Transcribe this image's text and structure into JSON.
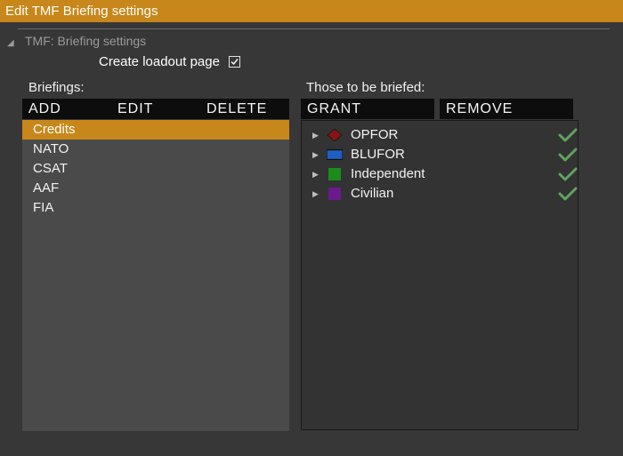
{
  "window": {
    "title": "Edit TMF Briefing settings"
  },
  "section": {
    "title": "TMF: Briefing settings"
  },
  "loadout": {
    "label": "Create loadout page",
    "checked": true
  },
  "briefings": {
    "label": "Briefings:",
    "toolbar": {
      "add": "ADD",
      "edit": "EDIT",
      "delete": "DELETE"
    },
    "items": [
      {
        "label": "Credits",
        "selected": true
      },
      {
        "label": "NATO"
      },
      {
        "label": "CSAT"
      },
      {
        "label": "AAF"
      },
      {
        "label": "FIA"
      }
    ]
  },
  "briefed": {
    "label": "Those to be briefed:",
    "toolbar": {
      "grant": "GRANT",
      "remove": "REMOVE"
    },
    "items": [
      {
        "label": "OPFOR",
        "icon": "diamond-icon",
        "color": "#8b1212",
        "granted": true
      },
      {
        "label": "BLUFOR",
        "icon": "flag-icon",
        "color": "#1f5fbf",
        "granted": true
      },
      {
        "label": "Independent",
        "icon": "square-icon",
        "color": "#1a8c1a",
        "granted": true
      },
      {
        "label": "Civilian",
        "icon": "square-icon",
        "color": "#6a1a8c",
        "granted": true
      }
    ]
  },
  "colors": {
    "accent": "#c8871a",
    "check": "#5fa35f"
  }
}
